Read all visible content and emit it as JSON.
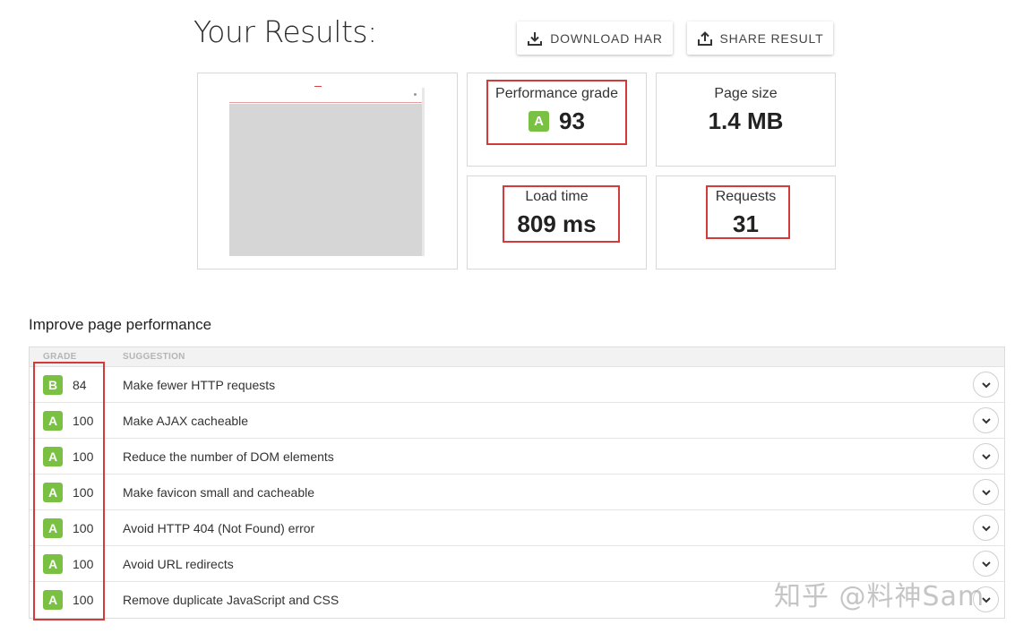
{
  "header": {
    "title": "Your Results:",
    "download_label": "DOWNLOAD HAR",
    "share_label": "SHARE RESULT"
  },
  "metrics": {
    "performance": {
      "label": "Performance grade",
      "grade": "A",
      "value": "93"
    },
    "page_size": {
      "label": "Page size",
      "value": "1.4 MB"
    },
    "load_time": {
      "label": "Load time",
      "value": "809 ms"
    },
    "requests": {
      "label": "Requests",
      "value": "31"
    }
  },
  "improve": {
    "title": "Improve page performance",
    "col_grade": "GRADE",
    "col_suggestion": "SUGGESTION",
    "rows": [
      {
        "grade": "B",
        "score": "84",
        "suggestion": "Make fewer HTTP requests"
      },
      {
        "grade": "A",
        "score": "100",
        "suggestion": "Make AJAX cacheable"
      },
      {
        "grade": "A",
        "score": "100",
        "suggestion": "Reduce the number of DOM elements"
      },
      {
        "grade": "A",
        "score": "100",
        "suggestion": "Make favicon small and cacheable"
      },
      {
        "grade": "A",
        "score": "100",
        "suggestion": "Avoid HTTP 404 (Not Found) error"
      },
      {
        "grade": "A",
        "score": "100",
        "suggestion": "Avoid URL redirects"
      },
      {
        "grade": "A",
        "score": "100",
        "suggestion": "Remove duplicate JavaScript and CSS"
      }
    ]
  },
  "watermark": "知乎 @料神Sam",
  "colors": {
    "grade_green": "#7ac143",
    "highlight_red": "#d43a3a"
  }
}
